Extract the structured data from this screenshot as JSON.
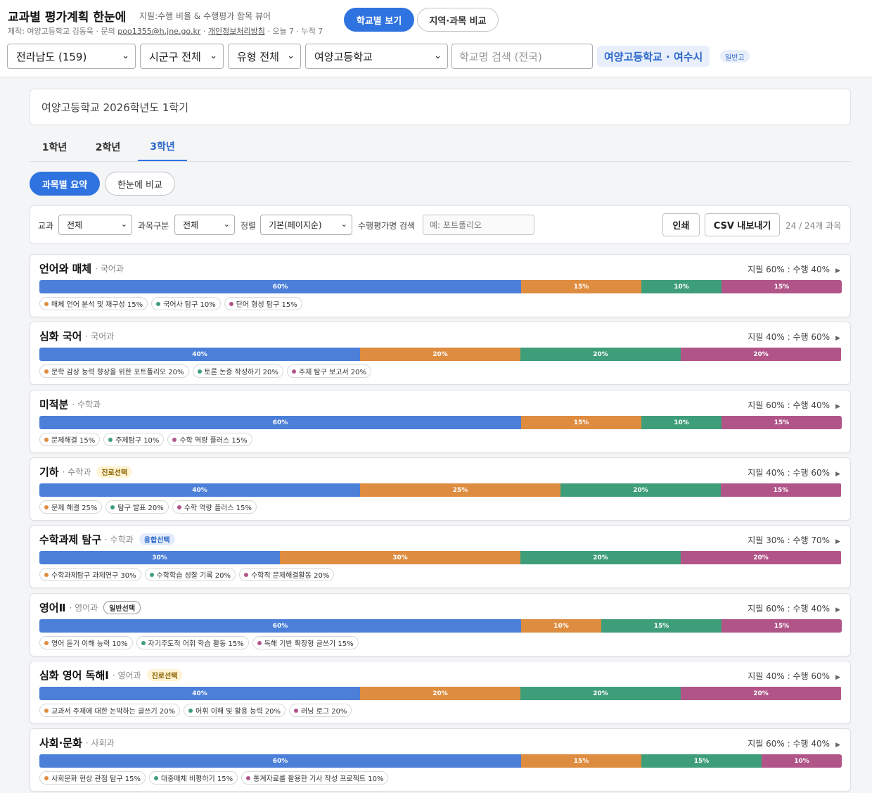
{
  "header": {
    "title": "교과별 평가계획 한눈에",
    "subtitle": "지필:수행 비율 & 수행평가 항목 뷰어",
    "credit_prefix": "제작: 여양고등학교 김동욱 · 문의",
    "credit_email": "poo1355@h.jne.go.kr",
    "credit_sep": "·",
    "credit_privacy": "개인정보처리방침",
    "credit_stats": "· 오늘 7 · 누적 7",
    "view_school": "학교별 보기",
    "view_compare": "지역·과목 비교"
  },
  "selectors": {
    "region": "전라남도 (159)",
    "district": "시군구 전체",
    "type": "유형 전체",
    "school": "여양고등학교",
    "search_placeholder": "학교명 검색 (전국)",
    "school_chip": "여양고등학교 · 여수시",
    "type_chip": "일반고"
  },
  "info": {
    "text": "여양고등학교 2026학년도 1학기"
  },
  "grades": [
    "1학년",
    "2학년",
    "3학년"
  ],
  "active_grade": 2,
  "modes": {
    "summary": "과목별 요약",
    "compare": "한눈에 비교"
  },
  "filters": {
    "subject_label": "교과",
    "subject_value": "전체",
    "category_label": "과목구분",
    "category_value": "전체",
    "sort_label": "정렬",
    "sort_value": "기본(페이지순)",
    "search_label": "수행평가명 검색",
    "search_placeholder": "예: 포트폴리오",
    "print_label": "인쇄",
    "csv_label": "CSV 내보내기",
    "count_text": "24 / 24개 과목"
  },
  "colors": {
    "written": "#4b7fd8",
    "item1": "#de8c3f",
    "item2": "#3f9e7a",
    "item3": "#b15589",
    "accent": "#2f73e0"
  },
  "subjects": [
    {
      "name": "언어와 매체",
      "dept": "· 국어과",
      "badge": "",
      "badge_type": "",
      "ratio": "지필 60% : 수행 40%",
      "segments": [
        {
          "label": "60%",
          "value": 60
        },
        {
          "label": "15%",
          "value": 15
        },
        {
          "label": "10%",
          "value": 10
        },
        {
          "label": "15%",
          "value": 15
        }
      ],
      "items": [
        "매체 언어 분석 및 재구성 15%",
        "국어사 탐구 10%",
        "단어 형성 탐구 15%"
      ]
    },
    {
      "name": "심화 국어",
      "dept": "· 국어과",
      "badge": "",
      "badge_type": "",
      "ratio": "지필 40% : 수행 60%",
      "segments": [
        {
          "label": "40%",
          "value": 40
        },
        {
          "label": "20%",
          "value": 20
        },
        {
          "label": "20%",
          "value": 20
        },
        {
          "label": "20%",
          "value": 20
        }
      ],
      "items": [
        "문학 감상 능력 향상을 위한 포트폴리오 20%",
        "토론 논증 작성하기 20%",
        "주제 탐구 보고서 20%"
      ]
    },
    {
      "name": "미적분",
      "dept": "· 수학과",
      "badge": "",
      "badge_type": "",
      "ratio": "지필 60% : 수행 40%",
      "segments": [
        {
          "label": "60%",
          "value": 60
        },
        {
          "label": "15%",
          "value": 15
        },
        {
          "label": "10%",
          "value": 10
        },
        {
          "label": "15%",
          "value": 15
        }
      ],
      "items": [
        "문제해결 15%",
        "주제탐구 10%",
        "수학 역량 플러스 15%"
      ]
    },
    {
      "name": "기하",
      "dept": "· 수학과",
      "badge": "진로선택",
      "badge_type": "career",
      "ratio": "지필 40% : 수행 60%",
      "segments": [
        {
          "label": "40%",
          "value": 40
        },
        {
          "label": "25%",
          "value": 25
        },
        {
          "label": "20%",
          "value": 20
        },
        {
          "label": "15%",
          "value": 15
        }
      ],
      "items": [
        "문제 해결 25%",
        "탐구 발표 20%",
        "수학 역량 플러스 15%"
      ]
    },
    {
      "name": "수학과제 탐구",
      "dept": "· 수학과",
      "badge": "융합선택",
      "badge_type": "fusion",
      "ratio": "지필 30% : 수행 70%",
      "segments": [
        {
          "label": "30%",
          "value": 30
        },
        {
          "label": "30%",
          "value": 30
        },
        {
          "label": "20%",
          "value": 20
        },
        {
          "label": "20%",
          "value": 20
        }
      ],
      "items": [
        "수학과제탐구 과제연구 30%",
        "수학학습 성찰 기록 20%",
        "수학적 문제해결활동 20%"
      ]
    },
    {
      "name": "영어Ⅱ",
      "dept": "· 영어과",
      "badge": "일반선택",
      "badge_type": "general",
      "ratio": "지필 60% : 수행 40%",
      "segments": [
        {
          "label": "60%",
          "value": 60
        },
        {
          "label": "10%",
          "value": 10
        },
        {
          "label": "15%",
          "value": 15
        },
        {
          "label": "15%",
          "value": 15
        }
      ],
      "items": [
        "영어 듣기 이해 능력 10%",
        "자기주도적 어휘 학습 활동 15%",
        "독해 기반 확장형 글쓰기 15%"
      ]
    },
    {
      "name": "심화 영어 독해Ⅰ",
      "dept": "· 영어과",
      "badge": "진로선택",
      "badge_type": "career",
      "ratio": "지필 40% : 수행 60%",
      "segments": [
        {
          "label": "40%",
          "value": 40
        },
        {
          "label": "20%",
          "value": 20
        },
        {
          "label": "20%",
          "value": 20
        },
        {
          "label": "20%",
          "value": 20
        }
      ],
      "items": [
        "교과서 주제에 대한 논박하는 글쓰기 20%",
        "어휘 이해 및 활용 능력 20%",
        "러닝 로그 20%"
      ]
    },
    {
      "name": "사회·문화",
      "dept": "· 사회과",
      "badge": "",
      "badge_type": "",
      "ratio": "지필 60% : 수행 40%",
      "segments": [
        {
          "label": "60%",
          "value": 60
        },
        {
          "label": "15%",
          "value": 15
        },
        {
          "label": "15%",
          "value": 15
        },
        {
          "label": "10%",
          "value": 10
        }
      ],
      "items": [
        "사회문화 현상 관점 탐구 15%",
        "대중매체 비평하기 15%",
        "통계자료를 활용한 기사 작성 프로젝트 10%"
      ]
    }
  ]
}
